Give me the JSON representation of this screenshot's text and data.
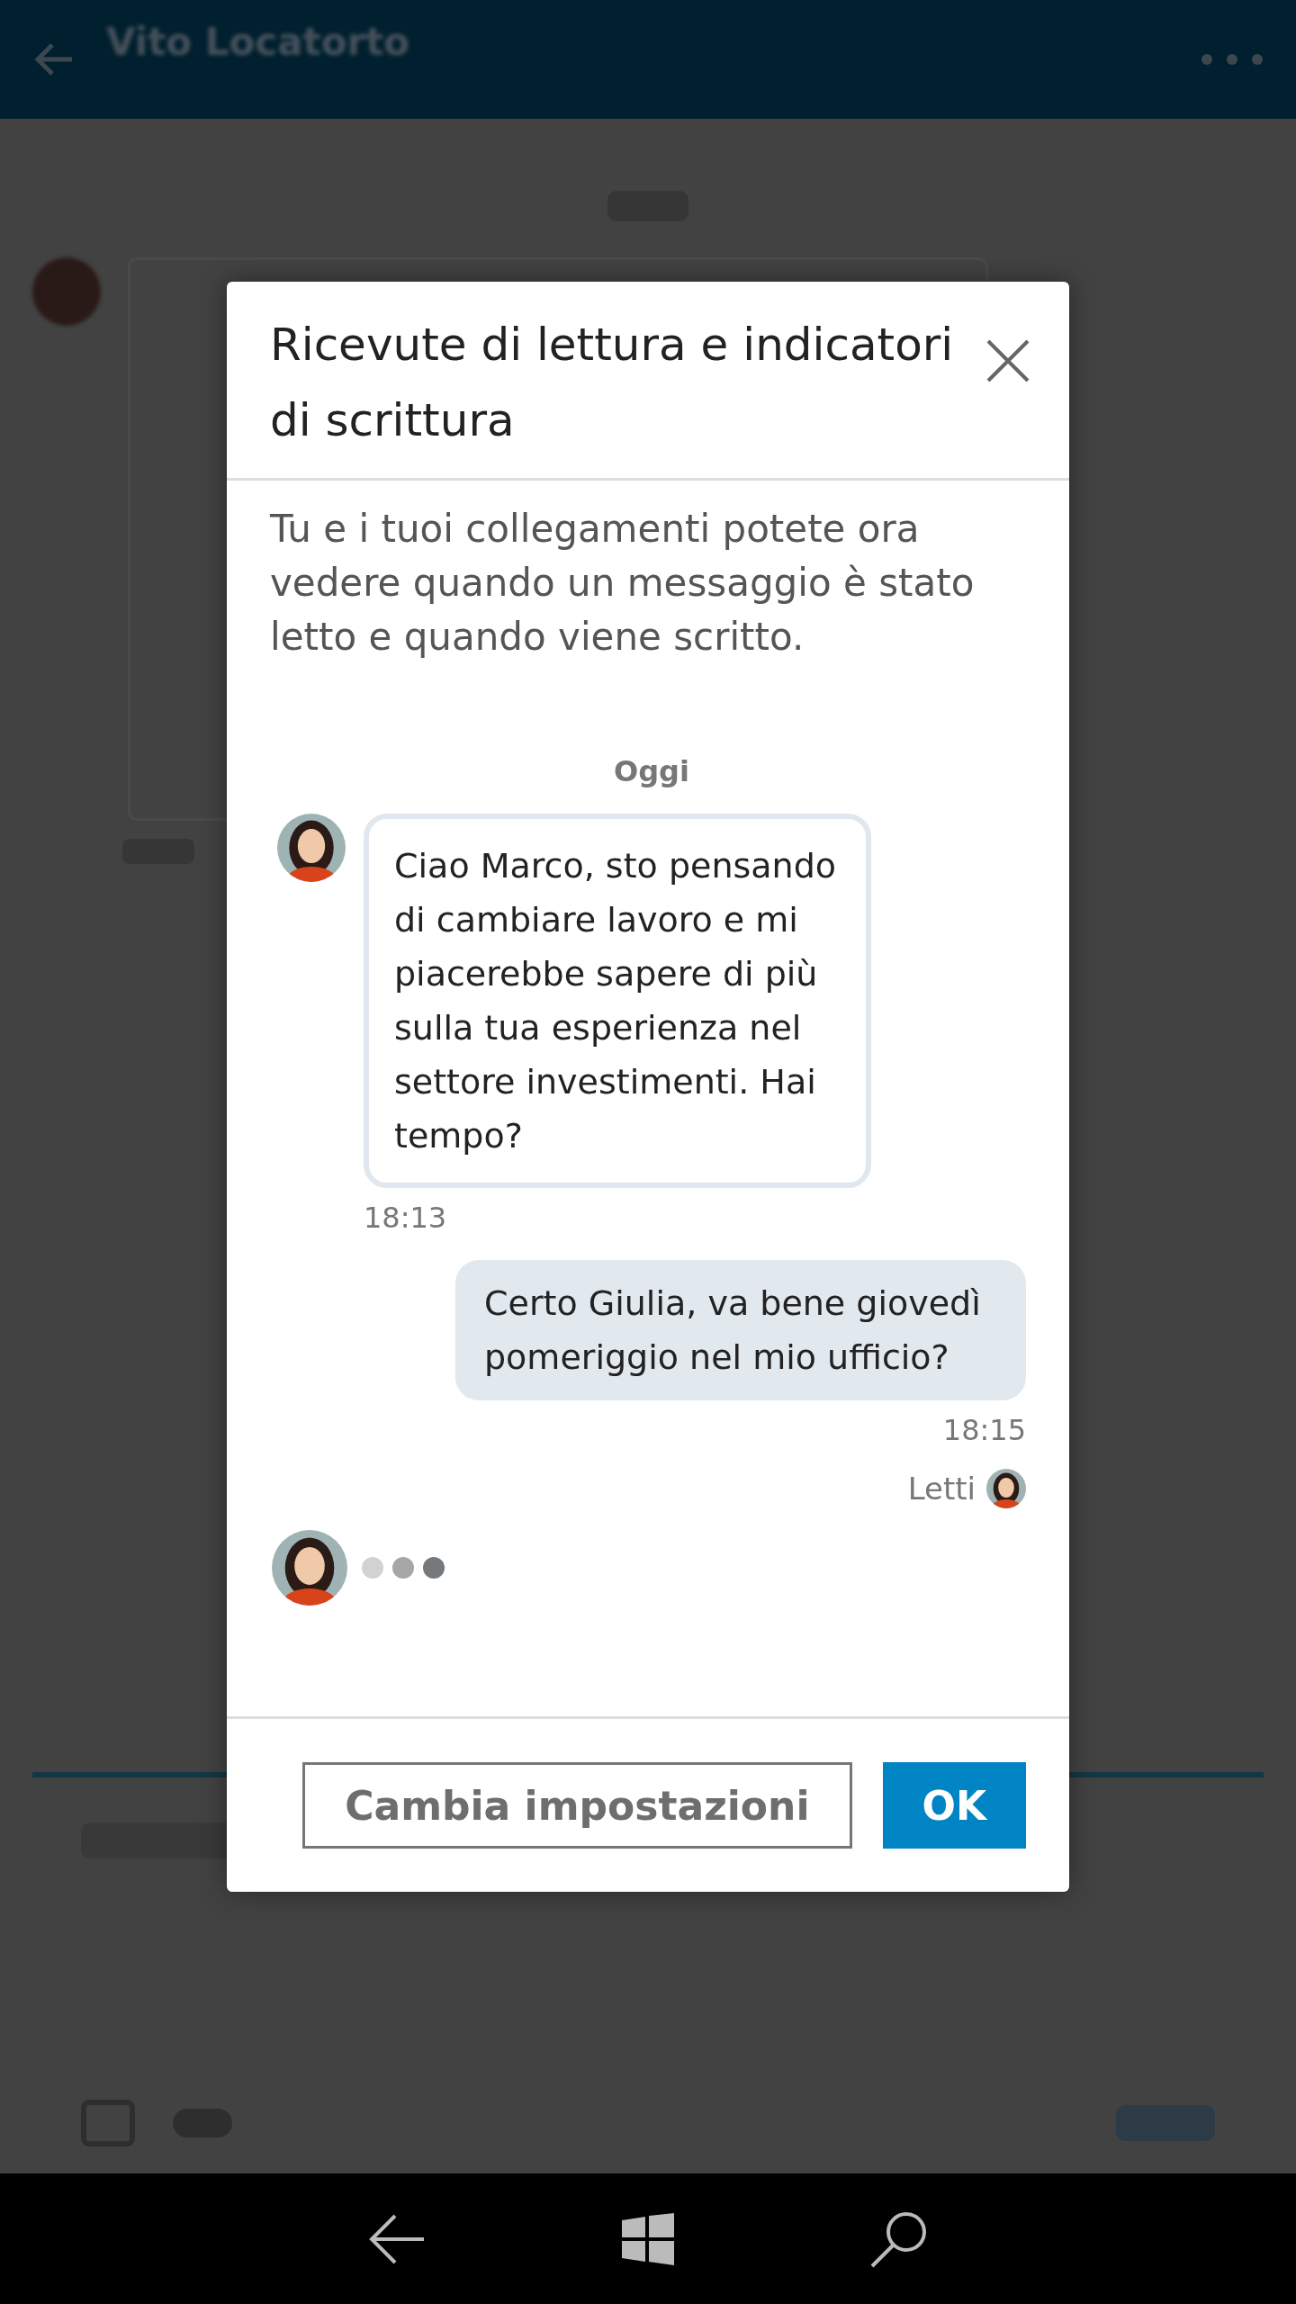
{
  "header": {
    "title": "Vito Locatorto"
  },
  "dialog": {
    "title": "Ricevute di lettura e indicatori di scrittura",
    "description": "Tu e i tuoi collegamenti potete ora vedere quando un messaggio è stato letto e quando viene scritto.",
    "preview": {
      "date": "Oggi",
      "messages": [
        {
          "kind": "received",
          "text": "Ciao Marco, sto pensando di cambiare lavoro e mi piacerebbe sapere di più sulla tua esperienza nel settore investimenti. Hai tempo?",
          "time": "18:13"
        },
        {
          "kind": "sent",
          "text": "Certo Giulia, va bene giovedì pomeriggio nel mio ufficio?",
          "time": "18:15"
        }
      ],
      "read_label": "Letti",
      "typing": true
    },
    "buttons": [
      {
        "kind": "secondary",
        "label": "Cambia impostazioni"
      },
      {
        "kind": "primary",
        "label": "OK"
      }
    ]
  }
}
